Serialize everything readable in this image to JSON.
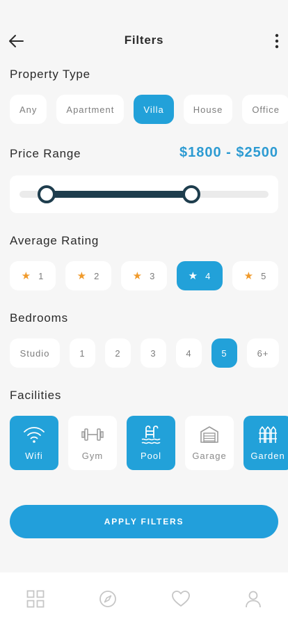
{
  "header": {
    "title": "Filters"
  },
  "property_type": {
    "title": "Property Type",
    "options": [
      "Any",
      "Apartment",
      "Villa",
      "House",
      "Office"
    ],
    "selected": "Villa"
  },
  "price": {
    "title": "Price Range",
    "value": "$1800 - $2500",
    "min_fraction": 0.11,
    "max_fraction": 0.69
  },
  "rating": {
    "title": "Average Rating",
    "options": [
      "1",
      "2",
      "3",
      "4",
      "5"
    ],
    "selected": "4"
  },
  "bedrooms": {
    "title": "Bedrooms",
    "options": [
      "Studio",
      "1",
      "2",
      "3",
      "4",
      "5",
      "6+"
    ],
    "selected": "5"
  },
  "facilities": {
    "title": "Facilities",
    "items": [
      {
        "label": "Wifi",
        "icon": "wifi-icon",
        "active": true
      },
      {
        "label": "Gym",
        "icon": "dumbbell-icon",
        "active": false
      },
      {
        "label": "Pool",
        "icon": "pool-icon",
        "active": true
      },
      {
        "label": "Garage",
        "icon": "garage-icon",
        "active": false
      },
      {
        "label": "Garden",
        "icon": "garden-icon",
        "active": true
      }
    ]
  },
  "apply": {
    "label": "APPLY FILTERS"
  },
  "nav": {
    "items": [
      {
        "icon": "grid-icon"
      },
      {
        "icon": "compass-icon"
      },
      {
        "icon": "heart-icon"
      },
      {
        "icon": "user-icon"
      }
    ]
  },
  "colors": {
    "accent": "#22a1d9",
    "price_text": "#2d9bd2",
    "slider_dark": "#1e3d4d",
    "star": "#f09a2b"
  }
}
